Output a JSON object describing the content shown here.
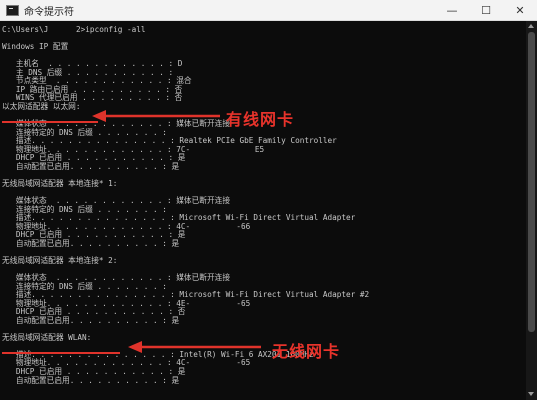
{
  "window": {
    "title": "命令提示符",
    "minimize_glyph": "—",
    "maximize_glyph": "☐",
    "close_glyph": "✕"
  },
  "terminal": {
    "lines": [
      "C:\\Users\\J      2>ipconfig -all",
      "",
      "Windows IP 配置",
      "",
      "   主机名  . . . . . . . . . . . . . : D",
      "   主 DNS 后缀 . . . . . . . . . . . :",
      "   节点类型  . . . . . . . . . . . . : 混合",
      "   IP 路由已启用 . . . . . . . . . . : 否",
      "   WINS 代理已启用 . . . . . . . . . : 否",
      "以太网适配器 以太网:",
      "",
      "   媒体状态  . . . . . . . . . . . . : 媒体已断开连接",
      "   连接特定的 DNS 后缀 . . . . . . . :",
      "   描述. . . . . . . . . . . . . . . : Realtek PCIe GbE Family Controller",
      "   物理地址. . . . . . . . . . . . . : 7C-              E5",
      "   DHCP 已启用 . . . . . . . . . . . : 是",
      "   自动配置已启用. . . . . . . . . . : 是",
      "",
      "无线局域网适配器 本地连接* 1:",
      "",
      "   媒体状态  . . . . . . . . . . . . : 媒体已断开连接",
      "   连接特定的 DNS 后缀 . . . . . . . :",
      "   描述. . . . . . . . . . . . . . . : Microsoft Wi-Fi Direct Virtual Adapter",
      "   物理地址. . . . . . . . . . . . . : 4C-          -66",
      "   DHCP 已启用 . . . . . . . . . . . : 是",
      "   自动配置已启用. . . . . . . . . . : 是",
      "",
      "无线局域网适配器 本地连接* 2:",
      "",
      "   媒体状态  . . . . . . . . . . . . : 媒体已断开连接",
      "   连接特定的 DNS 后缀 . . . . . . . :",
      "   描述. . . . . . . . . . . . . . . : Microsoft Wi-Fi Direct Virtual Adapter #2",
      "   物理地址. . . . . . . . . . . . . : 4E-          -65",
      "   DHCP 已启用 . . . . . . . . . . . : 否",
      "   自动配置已启用. . . . . . . . . . : 是",
      "",
      "无线局域网适配器 WLAN:",
      "",
      "   描述. . . . . . . . . . . . . . . : Intel(R) Wi-Fi 6 AX201 160MHz",
      "   物理地址. . . . . . . . . . . . . : 4C-          -65",
      "   DHCP 已启用 . . . . . . . . . . . : 是",
      "   自动配置已启用. . . . . . . . . . : 是"
    ]
  },
  "annotations": {
    "wired_label": "有线网卡",
    "wireless_label": "无线网卡",
    "color": "#e8332b"
  },
  "icons": {
    "app": "cmd-icon",
    "scroll_up": "scroll-up-arrow-icon",
    "scroll_down": "scroll-down-arrow-icon"
  }
}
